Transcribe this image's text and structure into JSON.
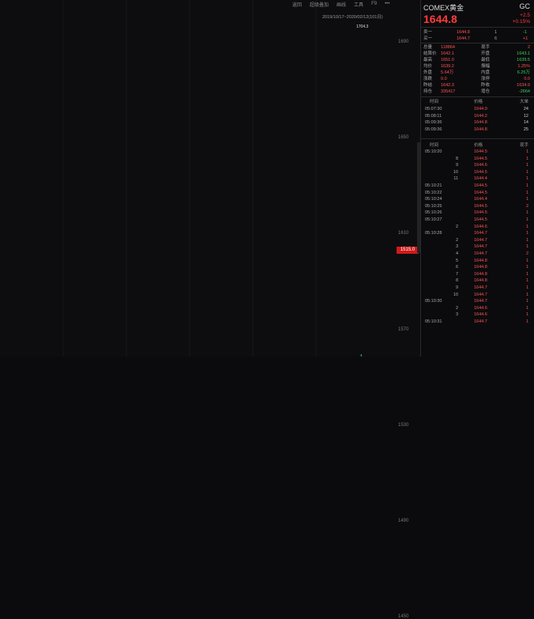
{
  "toolbar": [
    "返回",
    "超级叠加",
    "画线",
    "工具",
    "F9",
    "•••"
  ],
  "chart": {
    "date_range": "2019/10/17~2020/02/12(101日)",
    "high_label": "1704.3",
    "current_tag": "1515.0",
    "axis_ticks": [
      {
        "label": "1690",
        "v": 1690
      },
      {
        "label": "1650",
        "v": 1650
      },
      {
        "label": "1610",
        "v": 1610
      },
      {
        "label": "1570",
        "v": 1570
      },
      {
        "label": "1530",
        "v": 1530
      },
      {
        "label": "1490",
        "v": 1490
      },
      {
        "label": "1450",
        "v": 1450
      }
    ],
    "colors": {
      "up": "#ff3b3b",
      "down": "#3fe0d0",
      "ma5": "#d8d8d8",
      "ma10": "#e6c34a",
      "ma20": "#d23bd2",
      "ma60": "#27a527",
      "ma120": "#8fd8d8"
    }
  },
  "quote": {
    "name": "COMEX黄金",
    "code": "GC",
    "price": "1644.8",
    "change": "+2.5",
    "change_pct": "+0.15%",
    "book": [
      {
        "label": "卖一",
        "price": "1644.8",
        "vol": "1",
        "delta": "-1"
      },
      {
        "label": "买一",
        "price": "1644.7",
        "vol": "6",
        "delta": "+1"
      }
    ],
    "stats": [
      {
        "a": "总量",
        "av": "118864",
        "b": "现手",
        "bv": "2",
        "ag": false,
        "bg": false
      },
      {
        "a": "结算价",
        "av": "1642.1",
        "b": "开盘",
        "bv": "1643.1",
        "ag": false,
        "bg": true
      },
      {
        "a": "最高",
        "av": "1651.0",
        "b": "最低",
        "bv": "1639.5",
        "ag": false,
        "bg": true
      },
      {
        "a": "均价",
        "av": "1639.2",
        "b": "振幅",
        "bv": "1.25%",
        "ag": false,
        "bg": false
      },
      {
        "a": "外盘",
        "av": "5.64万",
        "b": "内盘",
        "bv": "6.25万",
        "ag": false,
        "bg": true
      },
      {
        "a": "涨跌",
        "av": "0.0",
        "b": "涨停",
        "bv": "0.0",
        "ag": false,
        "bg": false
      },
      {
        "a": "昨结",
        "av": "1642.3",
        "b": "昨收",
        "bv": "1634.9",
        "ag": false,
        "bg": false
      },
      {
        "a": "持仓",
        "av": "335417",
        "b": "增仓",
        "bv": "-2664",
        "ag": false,
        "bg": true
      }
    ],
    "headers1": [
      "时间",
      "价格",
      "大单"
    ],
    "trades1": [
      {
        "t": "05:07:30",
        "p": "1644.9",
        "v": "24"
      },
      {
        "t": "05:08:11",
        "p": "1644.2",
        "v": "12"
      },
      {
        "t": "05:09:36",
        "p": "1644.8",
        "v": "14"
      },
      {
        "t": "05:09:36",
        "p": "1644.8",
        "v": "25"
      }
    ],
    "headers2": [
      "时间",
      "价格",
      "现手"
    ],
    "trades2": [
      {
        "t": "05:10:20",
        "p": "1644.5",
        "v": "1"
      },
      {
        "t": "8",
        "p": "1644.5",
        "v": "1"
      },
      {
        "t": "9",
        "p": "1644.6",
        "v": "1"
      },
      {
        "t": "10",
        "p": "1644.5",
        "v": "1"
      },
      {
        "t": "11",
        "p": "1644.4",
        "v": "1"
      },
      {
        "t": "05:10:21",
        "p": "1644.5",
        "v": "1"
      },
      {
        "t": "05:10:22",
        "p": "1644.5",
        "v": "1"
      },
      {
        "t": "05:10:24",
        "p": "1644.4",
        "v": "1"
      },
      {
        "t": "05:10:25",
        "p": "1644.5",
        "v": "2"
      },
      {
        "t": "05:10:26",
        "p": "1644.5",
        "v": "1"
      },
      {
        "t": "05:10:27",
        "p": "1644.5",
        "v": "1"
      },
      {
        "t": "2",
        "p": "1644.6",
        "v": "1"
      },
      {
        "t": "05:10:28",
        "p": "1644.7",
        "v": "1"
      },
      {
        "t": "2",
        "p": "1644.7",
        "v": "1"
      },
      {
        "t": "3",
        "p": "1644.7",
        "v": "1"
      },
      {
        "t": "4",
        "p": "1644.7",
        "v": "2"
      },
      {
        "t": "5",
        "p": "1644.8",
        "v": "1"
      },
      {
        "t": "6",
        "p": "1644.8",
        "v": "1"
      },
      {
        "t": "7",
        "p": "1644.8",
        "v": "1"
      },
      {
        "t": "8",
        "p": "1644.8",
        "v": "1"
      },
      {
        "t": "9",
        "p": "1644.7",
        "v": "1"
      },
      {
        "t": "10",
        "p": "1644.7",
        "v": "1"
      },
      {
        "t": "05:10:30",
        "p": "1644.7",
        "v": "1"
      },
      {
        "t": "2",
        "p": "1644.6",
        "v": "1"
      },
      {
        "t": "3",
        "p": "1644.6",
        "v": "1"
      },
      {
        "t": "05:10:31",
        "p": "1644.7",
        "v": "1"
      }
    ]
  }
}
